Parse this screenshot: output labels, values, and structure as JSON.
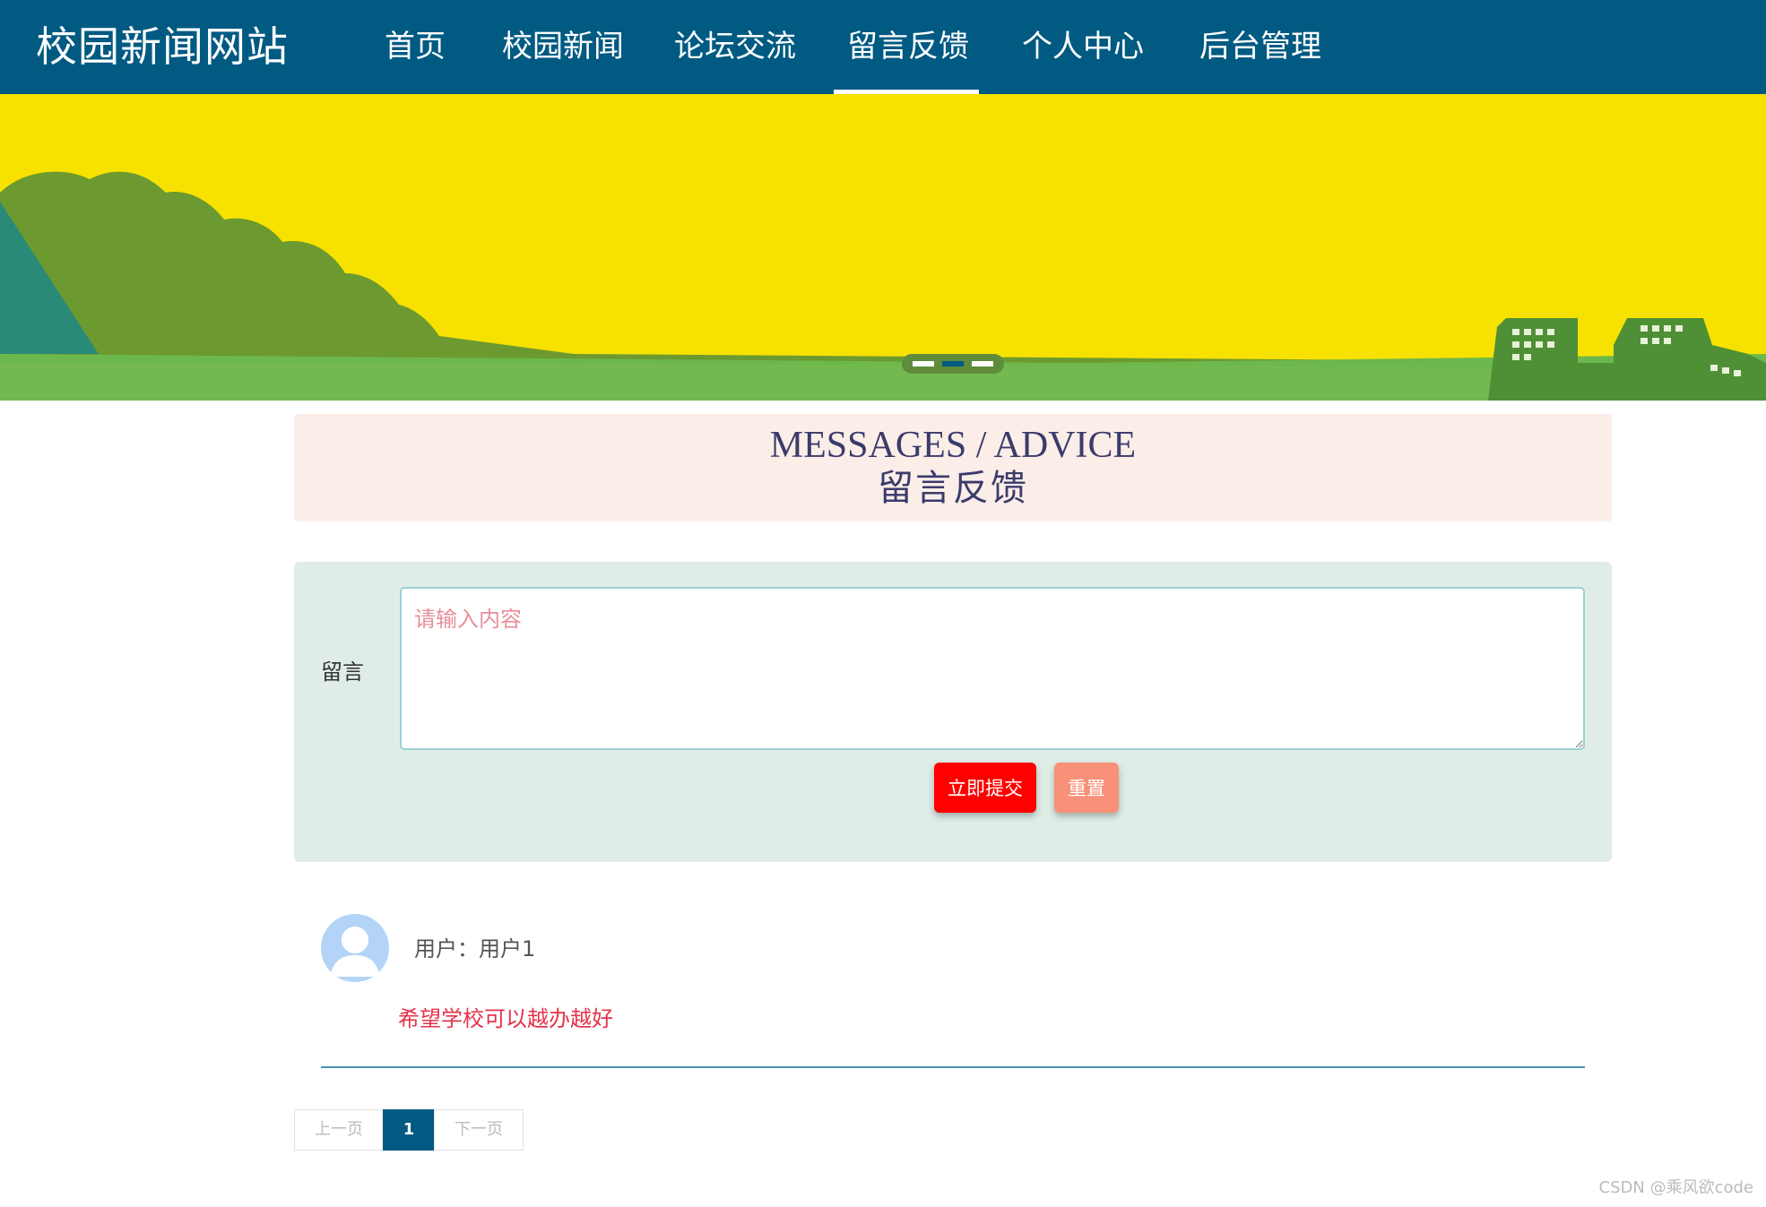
{
  "site": {
    "title": "校园新闻网站"
  },
  "nav": {
    "items": [
      {
        "label": "首页"
      },
      {
        "label": "校园新闻"
      },
      {
        "label": "论坛交流"
      },
      {
        "label": "留言反馈"
      },
      {
        "label": "个人中心"
      },
      {
        "label": "后台管理"
      }
    ],
    "active_index": 3
  },
  "banner": {
    "slide_count": 3,
    "active_slide": 2
  },
  "section": {
    "title_en": "MESSAGES / ADVICE",
    "title_cn": "留言反馈"
  },
  "form": {
    "label": "留言",
    "placeholder": "请输入内容",
    "value": "",
    "submit_label": "立即提交",
    "reset_label": "重置"
  },
  "messages": [
    {
      "user": "用户：用户1",
      "content": "希望学校可以越办越好"
    }
  ],
  "pagination": {
    "prev_label": "上一页",
    "current": "1",
    "next_label": "下一页"
  },
  "watermark": "CSDN @乘风欲code",
  "colors": {
    "nav_bg": "#005a82",
    "banner_sky": "#f7e100",
    "submit": "#ff0000",
    "reset": "#f79177",
    "message_text": "#e5334a"
  }
}
